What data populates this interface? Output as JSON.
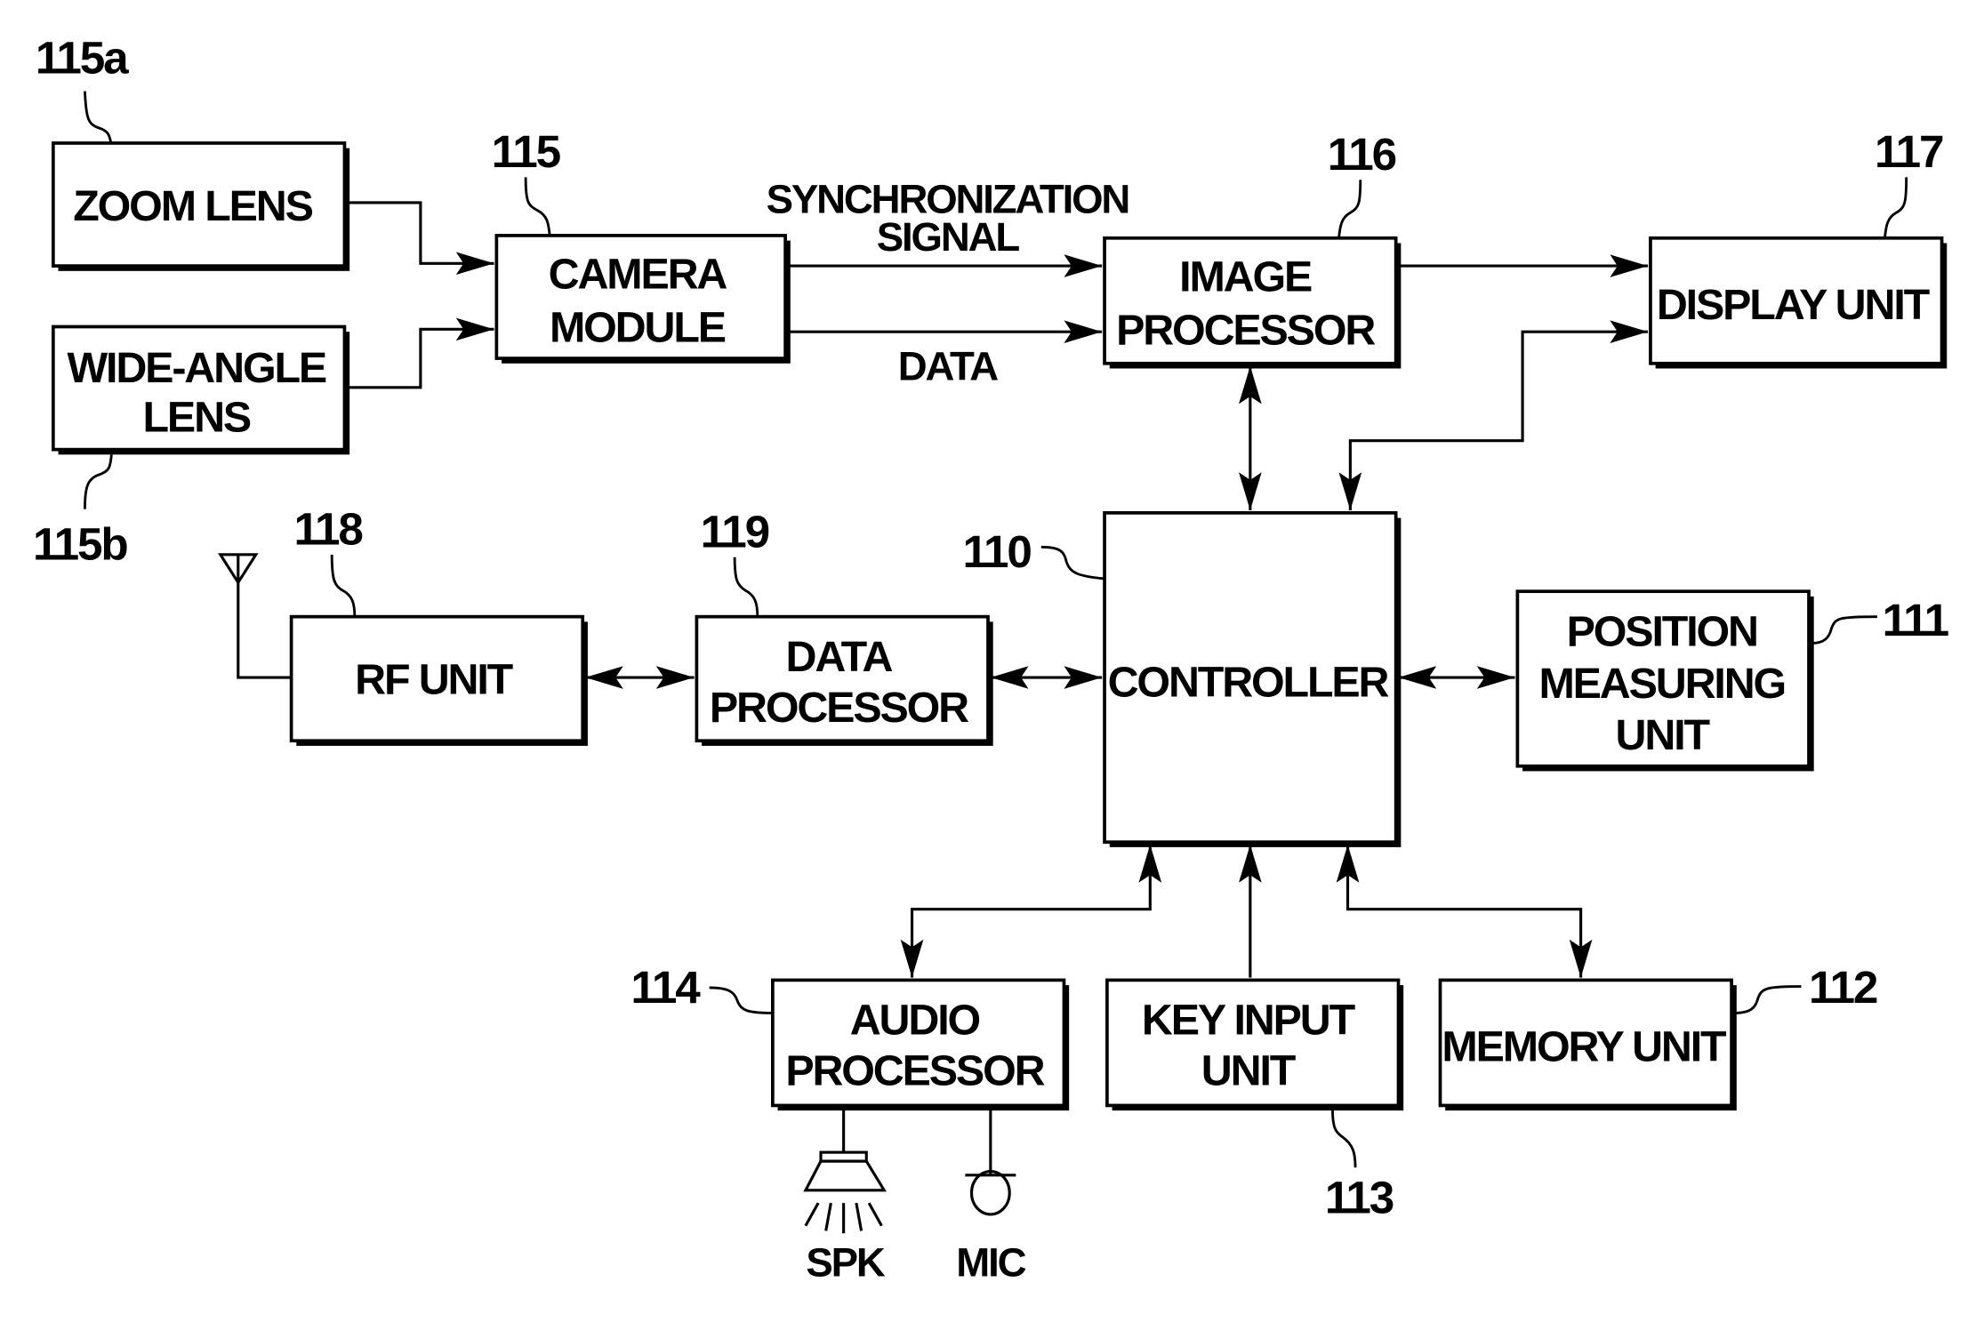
{
  "diagram": {
    "blocks": {
      "zoom_lens": {
        "ref": "115a",
        "lines": [
          "ZOOM LENS"
        ]
      },
      "wide_angle_lens": {
        "ref": "115b",
        "lines": [
          "WIDE-ANGLE",
          "LENS"
        ]
      },
      "camera_module": {
        "ref": "115",
        "lines": [
          "CAMERA",
          "MODULE"
        ]
      },
      "image_processor": {
        "ref": "116",
        "lines": [
          "IMAGE",
          "PROCESSOR"
        ]
      },
      "display_unit": {
        "ref": "117",
        "lines": [
          "DISPLAY UNIT"
        ]
      },
      "rf_unit": {
        "ref": "118",
        "lines": [
          "RF UNIT"
        ]
      },
      "data_processor": {
        "ref": "119",
        "lines": [
          "DATA",
          "PROCESSOR"
        ]
      },
      "controller": {
        "ref": "110",
        "lines": [
          "CONTROLLER"
        ]
      },
      "position_measuring_unit": {
        "ref": "111",
        "lines": [
          "POSITION",
          "MEASURING",
          "UNIT"
        ]
      },
      "memory_unit": {
        "ref": "112",
        "lines": [
          "MEMORY UNIT"
        ]
      },
      "key_input_unit": {
        "ref": "113",
        "lines": [
          "KEY INPUT",
          "UNIT"
        ]
      },
      "audio_processor": {
        "ref": "114",
        "lines": [
          "AUDIO",
          "PROCESSOR"
        ]
      }
    },
    "signals": {
      "sync_line1": "SYNCHRONIZATION",
      "sync_line2": "SIGNAL",
      "data": "DATA"
    },
    "peripherals": {
      "speaker": "SPK",
      "microphone": "MIC"
    }
  }
}
